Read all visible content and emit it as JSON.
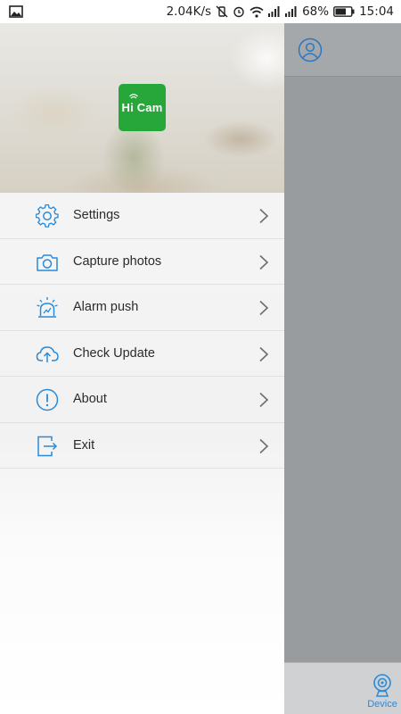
{
  "status_bar": {
    "speed": "2.04K/s",
    "battery": "68%",
    "time": "15:04"
  },
  "app": {
    "logo_text": "Hi Cam",
    "brand_color": "#27a63a",
    "accent_color": "#2a8ad8"
  },
  "menu": {
    "items": [
      {
        "label": "Settings",
        "icon": "gear-icon"
      },
      {
        "label": "Capture photos",
        "icon": "camera-icon"
      },
      {
        "label": "Alarm push",
        "icon": "alarm-icon"
      },
      {
        "label": "Check Update",
        "icon": "cloud-upload-icon"
      },
      {
        "label": "About",
        "icon": "info-icon"
      },
      {
        "label": "Exit",
        "icon": "exit-icon"
      }
    ]
  },
  "bottom_nav": {
    "device_label": "Device"
  }
}
